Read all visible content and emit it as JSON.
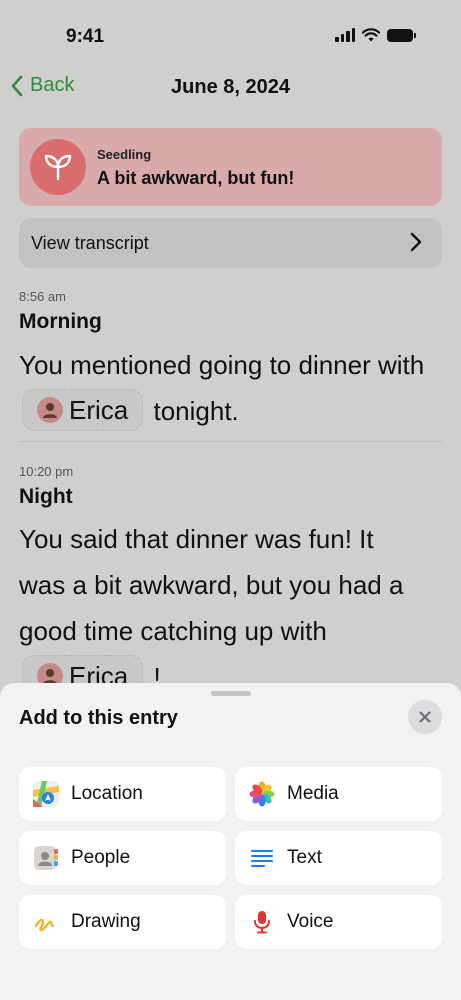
{
  "status_bar": {
    "time": "9:41"
  },
  "nav": {
    "back_label": "Back",
    "title": "June 8, 2024"
  },
  "mood": {
    "kicker": "Seedling",
    "summary": "A bit awkward, but fun!",
    "color": "#d96d6d"
  },
  "transcript": {
    "label": "View transcript"
  },
  "entries": [
    {
      "time": "8:56 am",
      "heading": "Morning",
      "text_before": "You mentioned going to dinner with",
      "person": "Erica",
      "text_after": "tonight."
    },
    {
      "time": "10:20 pm",
      "heading": "Night",
      "text_before": "You said that dinner was fun! It was a bit awkward, but you had a good time catching up with",
      "person": "Erica",
      "text_after": "!"
    }
  ],
  "sheet": {
    "title": "Add to this entry",
    "options": [
      {
        "label": "Location",
        "icon": "maps-icon"
      },
      {
        "label": "Media",
        "icon": "photos-icon"
      },
      {
        "label": "People",
        "icon": "contacts-icon"
      },
      {
        "label": "Text",
        "icon": "text-lines-icon"
      },
      {
        "label": "Drawing",
        "icon": "drawing-icon"
      },
      {
        "label": "Voice",
        "icon": "microphone-icon"
      }
    ]
  },
  "colors": {
    "accent_green": "#2f8a43",
    "sheet_bg": "#f2f2f4",
    "text_icon": "#1e7be0",
    "voice_icon": "#e0342f"
  }
}
